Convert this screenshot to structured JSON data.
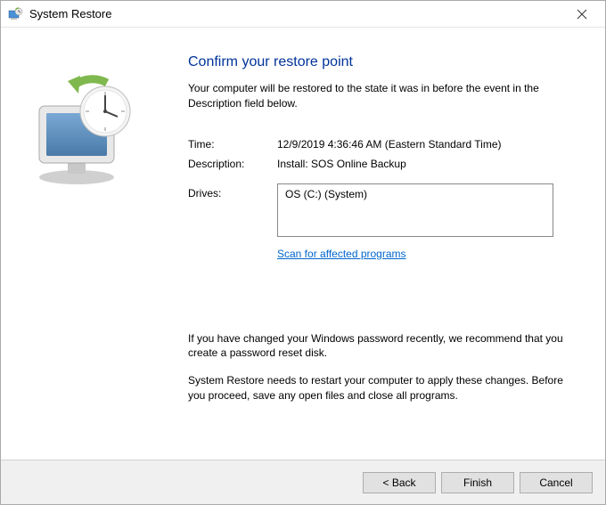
{
  "window": {
    "title": "System Restore"
  },
  "content": {
    "heading": "Confirm your restore point",
    "intro": "Your computer will be restored to the state it was in before the event in the Description field below.",
    "time_label": "Time:",
    "time_value": "12/9/2019 4:36:46 AM (Eastern Standard Time)",
    "description_label": "Description:",
    "description_value": "Install: SOS Online Backup",
    "drives_label": "Drives:",
    "drives_value": "OS (C:) (System)",
    "scan_link": "Scan for affected programs",
    "notice1": "If you have changed your Windows password recently, we recommend that you create a password reset disk.",
    "notice2": "System Restore needs to restart your computer to apply these changes. Before you proceed, save any open files and close all programs."
  },
  "buttons": {
    "back": "< Back",
    "finish": "Finish",
    "cancel": "Cancel"
  }
}
